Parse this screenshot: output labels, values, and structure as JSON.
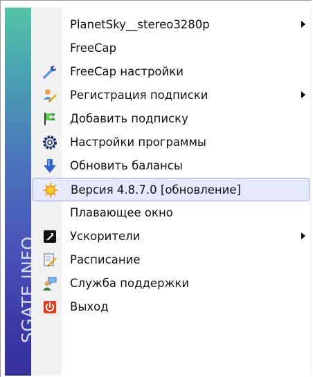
{
  "sidebar_band": {
    "text": "SGATE.INFO"
  },
  "menu": {
    "items": [
      {
        "label": "PlanetSky__stereo3280p",
        "icon": "",
        "submenu": true
      },
      {
        "label": "FreeCap",
        "icon": "",
        "submenu": false
      },
      {
        "label": "FreeCap настройки",
        "icon": "wrench-icon",
        "submenu": false
      },
      {
        "label": "Регистрация подписки",
        "icon": "user-edit-icon",
        "submenu": true
      },
      {
        "label": "Добавить подписку",
        "icon": "flag-add-icon",
        "submenu": false
      },
      {
        "label": "Настройки программы",
        "icon": "gear-icon",
        "submenu": false
      },
      {
        "label": "Обновить балансы",
        "icon": "download-arrow-icon",
        "submenu": false
      },
      {
        "label": "Версия 4.8.7.0 [обновление]",
        "icon": "sun-icon",
        "submenu": false,
        "highlighted": true
      },
      {
        "label": "Плавающее окно",
        "icon": "",
        "submenu": false
      },
      {
        "label": "Ускорители",
        "icon": "accelerator-icon",
        "submenu": true
      },
      {
        "label": "Расписание",
        "icon": "notepad-pencil-icon",
        "submenu": false
      },
      {
        "label": "Служба поддержки",
        "icon": "support-chat-icon",
        "submenu": false
      },
      {
        "label": "Выход",
        "icon": "power-icon",
        "submenu": false
      }
    ]
  },
  "colors": {
    "highlight_bg": "#e6e8fb",
    "highlight_border": "#9aa0ec",
    "band_top": "#55c4a6",
    "band_bottom": "#34309c"
  }
}
